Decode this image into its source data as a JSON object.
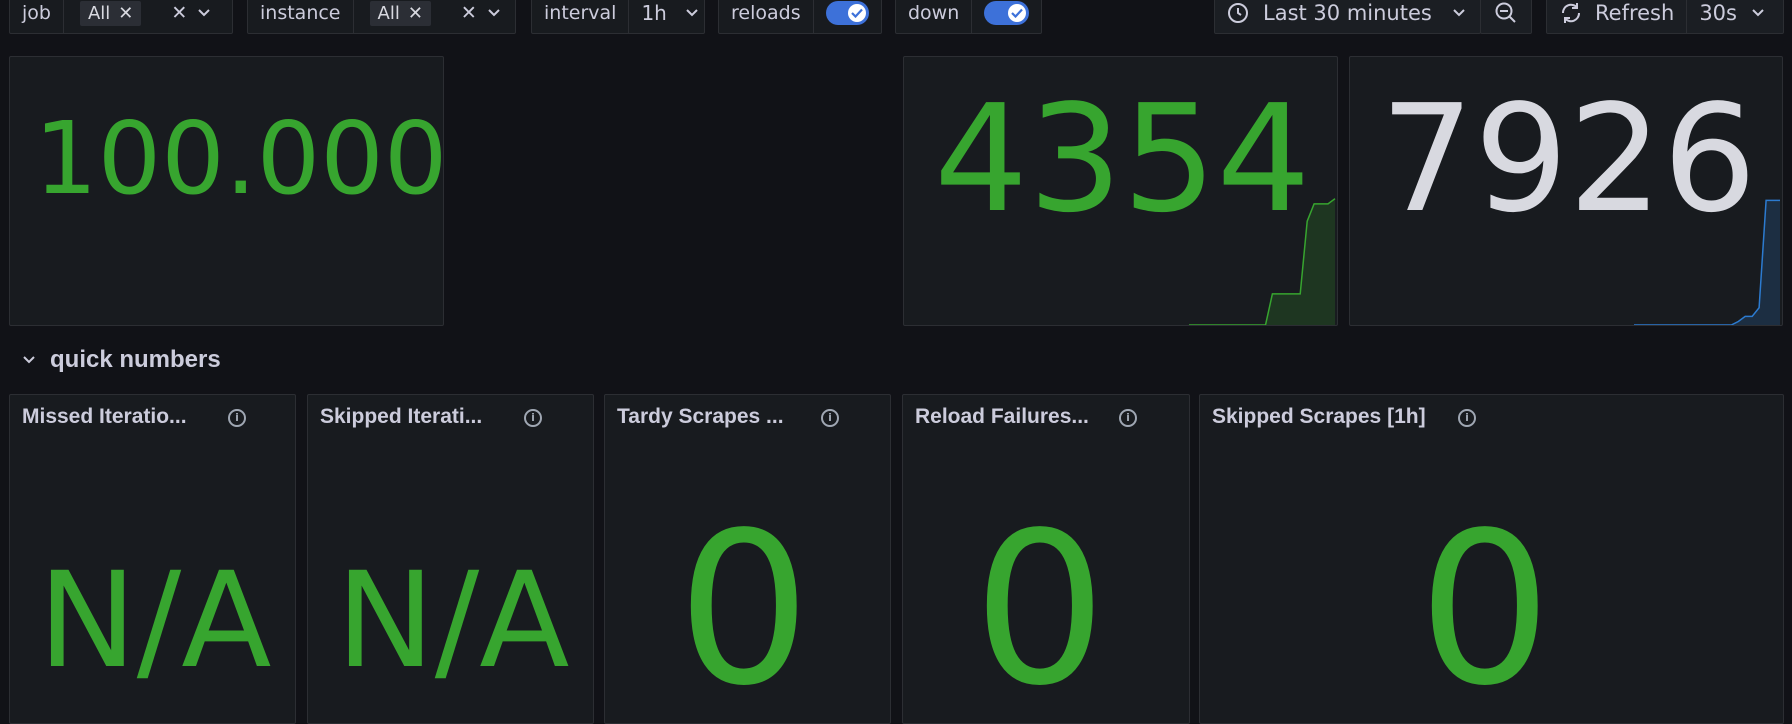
{
  "variables": [
    {
      "label": "job",
      "chip": "All"
    },
    {
      "label": "instance",
      "chip": "All"
    },
    {
      "label": "interval",
      "value": "1h"
    },
    {
      "label": "reloads",
      "toggle": true
    },
    {
      "label": "down",
      "toggle": true
    }
  ],
  "time_picker": {
    "label": "Last 30 minutes"
  },
  "refresh": {
    "label": "Refresh",
    "interval": "30s"
  },
  "top_panels": [
    {
      "value": "100.000",
      "color": "#37a52f"
    },
    {
      "value": "4354",
      "color": "#37a52f",
      "sparkline": [
        100,
        100,
        100,
        100,
        100,
        100,
        100,
        100,
        100,
        100,
        100,
        100,
        82,
        82,
        82,
        82,
        82,
        40,
        30,
        30,
        30,
        27
      ],
      "spark_color": "#37a52f"
    },
    {
      "value": "7926",
      "color": "#d8d9e0",
      "sparkline": [
        100,
        100,
        100,
        100,
        100,
        100,
        100,
        100,
        100,
        100,
        100,
        100,
        100,
        100,
        100,
        98,
        95,
        95,
        90,
        28,
        28,
        28
      ],
      "spark_color": "#2c7bd0"
    }
  ],
  "row": {
    "title": "quick numbers"
  },
  "quick_panels": [
    {
      "title": "Missed Iteratio...",
      "value": "N/A"
    },
    {
      "title": "Skipped Iterati...",
      "value": "N/A"
    },
    {
      "title": "Tardy Scrapes ...",
      "value": "0"
    },
    {
      "title": "Reload Failures...",
      "value": "0"
    },
    {
      "title": "Skipped Scrapes [1h]",
      "value": "0"
    }
  ]
}
